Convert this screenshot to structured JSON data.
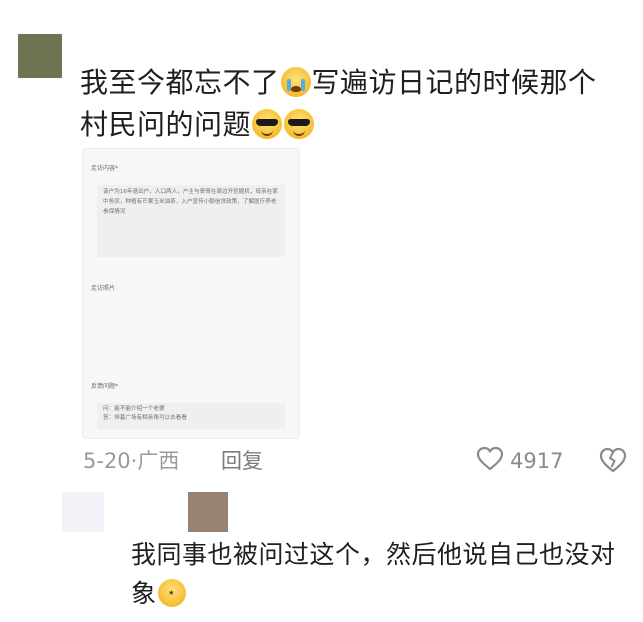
{
  "comment": {
    "text_part1": "我至今都忘不了",
    "emoji1": "loudly-crying-face",
    "text_part2": "写遍访日记的时候那个村民问的问题",
    "emoji2": "smiling-face-with-sunglasses",
    "emoji3": "smiling-face-with-sunglasses"
  },
  "card": {
    "visit_content_label": "走访内容*",
    "visit_content_text": "该户为16年退出户，人口两人，户主与哥哥在周边开挖掘机，母亲在家中务农，种植有芒果玉米油茶，入户宣传小额信贷政策，了解医疗养老参保情况",
    "visit_photo_label": "走访照片",
    "feedback_label": "反馈问题*",
    "feedback_q": "问：能不能介绍一个老婆",
    "feedback_a": "答：恒基广场有相亲角可以去看看"
  },
  "meta": {
    "date": "5-20",
    "dot": "·",
    "location": "广西",
    "reply_label": "回复",
    "like_count": "4917",
    "like_icon": "heart-outline-icon",
    "dislike_icon": "broken-heart-outline-icon"
  },
  "reply": {
    "text": "我同事也被问过这个，然后他说自己也没对象",
    "emoji": "rolling-on-floor-laughing"
  },
  "colors": {
    "avatar_main": "#6f7553",
    "avatar_reply": "#9a8273",
    "meta_text": "#9a9a9a",
    "card_bg": "#f7f7f7"
  }
}
